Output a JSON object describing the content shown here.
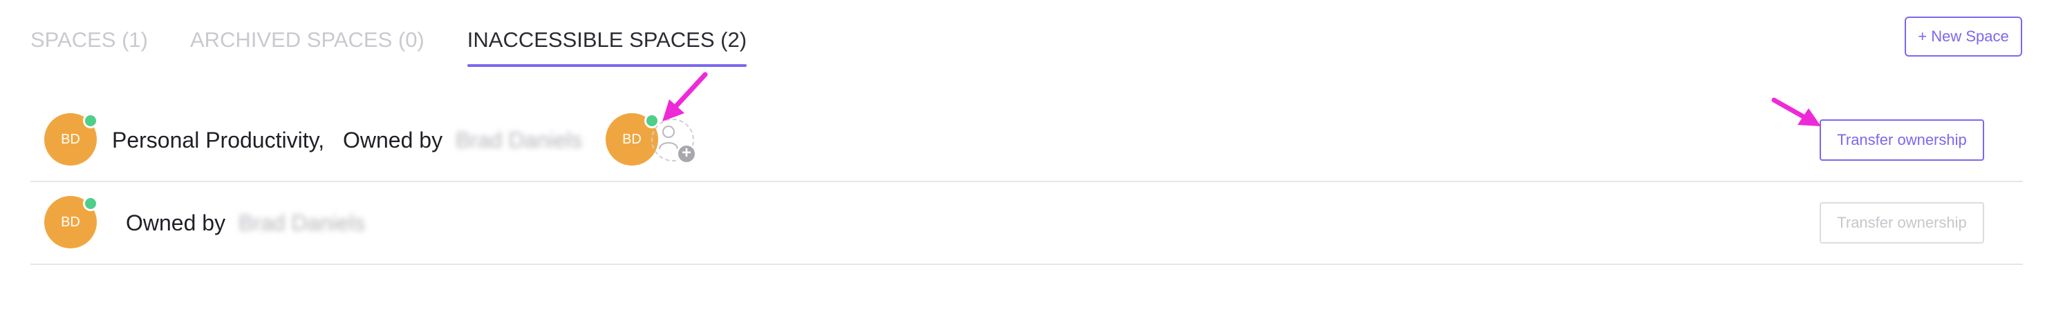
{
  "tabs": [
    {
      "label": "SPACES (1)",
      "active": false
    },
    {
      "label": "ARCHIVED SPACES (0)",
      "active": false
    },
    {
      "label": "INACCESSIBLE SPACES (2)",
      "active": true
    }
  ],
  "new_space_label": "+ New Space",
  "rows": [
    {
      "avatar_initials": "BD",
      "space_name": "Personal Productivity,",
      "owned_by_label": "Owned by",
      "owner_name": "Brad Daniels",
      "member_avatar_initials": "BD",
      "transfer_label": "Transfer ownership",
      "transfer_enabled": true
    },
    {
      "avatar_initials": "BD",
      "owned_by_label": "Owned by",
      "owner_name": "Brad Daniels",
      "transfer_label": "Transfer ownership",
      "transfer_enabled": false
    }
  ],
  "colors": {
    "accent": "#7b68ee",
    "avatar": "#f0a640",
    "online": "#4fce8a",
    "annotation_arrow": "#ee2ad8",
    "tab_inactive": "#c9c9cf"
  }
}
